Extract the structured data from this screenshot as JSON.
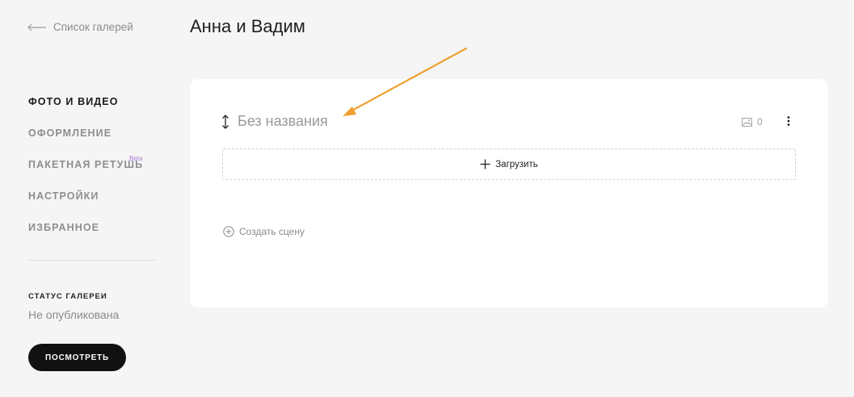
{
  "back": {
    "label": "Список галерей"
  },
  "page": {
    "title": "Анна и Вадим"
  },
  "sidebar": {
    "items": [
      {
        "label": "ФОТО И ВИДЕО",
        "active": true
      },
      {
        "label": "ОФОРМЛЕНИЕ"
      },
      {
        "label": "ПАКЕТНАЯ РЕТУШЬ",
        "badge": "Beta"
      },
      {
        "label": "НАСТРОЙКИ"
      },
      {
        "label": "ИЗБРАННОЕ"
      }
    ],
    "status_label": "СТАТУС ГАЛЕРЕИ",
    "status_value": "Не опубликована",
    "view_button": "ПОСМОТРЕТЬ"
  },
  "scene": {
    "name_placeholder": "Без названия",
    "photo_count": "0",
    "upload_label": "Загрузить",
    "create_scene_label": "Создать сцену"
  },
  "colors": {
    "background": "#f5f5f5",
    "card": "#ffffff",
    "accent_beta": "#b07ad8",
    "annotation_arrow": "#f0a030",
    "button": "#111111"
  },
  "icons": [
    "back-arrow-icon",
    "drag-handle-icon",
    "image-icon",
    "more-vertical-icon",
    "plus-icon",
    "plus-circle-icon",
    "annotation-arrow"
  ]
}
